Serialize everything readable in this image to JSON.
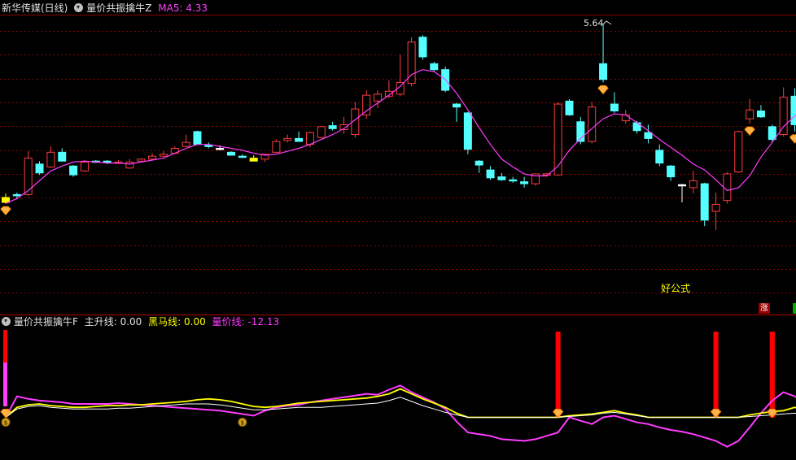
{
  "top_header": {
    "stock": "新华传媒(日线)",
    "indicator": "量价共振擒牛Z",
    "ma_label": "MA5: 4.33"
  },
  "bottom_header": {
    "indicator": "量价共振擒牛F",
    "main": "主升线: 0.00",
    "dark_horse": "黑马线: 0.00",
    "vol_price": "量价线: -12.13"
  },
  "max_label": "5.64",
  "watermark": "好公式",
  "zhang_badge": "涨",
  "colors": {
    "up": "#ff3c3c",
    "down": "#54ffff",
    "ma": "#ff3cff",
    "main": "#ffffff",
    "dark": "#ffff00",
    "vp": "#ff3cff",
    "signal": "#ff0000",
    "grid": "#8b0000"
  },
  "chart_data": {
    "type": "candlestick",
    "price_range": [
      3.35,
      5.76
    ],
    "candles": [
      {
        "o": 3.88,
        "h": 3.92,
        "l": 3.82,
        "c": 3.83,
        "col": "yellow"
      },
      {
        "o": 3.9,
        "h": 3.93,
        "l": 3.86,
        "c": 3.91,
        "col": "down"
      },
      {
        "o": 3.91,
        "h": 4.35,
        "l": 3.9,
        "c": 4.28
      },
      {
        "o": 4.22,
        "h": 4.25,
        "l": 4.11,
        "c": 4.13
      },
      {
        "o": 4.19,
        "h": 4.4,
        "l": 4.18,
        "c": 4.34
      },
      {
        "o": 4.34,
        "h": 4.38,
        "l": 4.25,
        "c": 4.25
      },
      {
        "o": 4.2,
        "h": 4.21,
        "l": 4.09,
        "c": 4.11
      },
      {
        "o": 4.15,
        "h": 4.26,
        "l": 4.14,
        "c": 4.24
      },
      {
        "o": 4.25,
        "h": 4.26,
        "l": 4.23,
        "c": 4.24
      },
      {
        "o": 4.25,
        "h": 4.26,
        "l": 4.22,
        "c": 4.235
      },
      {
        "o": 4.23,
        "h": 4.26,
        "l": 4.22,
        "c": 4.24
      },
      {
        "o": 4.18,
        "h": 4.27,
        "l": 4.17,
        "c": 4.24
      },
      {
        "o": 4.25,
        "h": 4.28,
        "l": 4.24,
        "c": 4.27
      },
      {
        "o": 4.27,
        "h": 4.33,
        "l": 4.26,
        "c": 4.3
      },
      {
        "o": 4.3,
        "h": 4.35,
        "l": 4.29,
        "c": 4.32
      },
      {
        "o": 4.33,
        "h": 4.4,
        "l": 4.32,
        "c": 4.38
      },
      {
        "o": 4.4,
        "h": 4.52,
        "l": 4.39,
        "c": 4.44
      },
      {
        "o": 4.55,
        "h": 4.56,
        "l": 4.42,
        "c": 4.42
      },
      {
        "o": 4.41,
        "h": 4.44,
        "l": 4.38,
        "c": 4.4
      },
      {
        "o": 4.37,
        "h": 4.41,
        "l": 4.36,
        "c": 4.38,
        "col": "white"
      },
      {
        "o": 4.34,
        "h": 4.35,
        "l": 4.31,
        "c": 4.31,
        "col": "down"
      },
      {
        "o": 4.3,
        "h": 4.32,
        "l": 4.28,
        "c": 4.29
      },
      {
        "o": 4.28,
        "h": 4.31,
        "l": 4.27,
        "c": 4.25,
        "col": "yellow"
      },
      {
        "o": 4.27,
        "h": 4.32,
        "l": 4.24,
        "c": 4.32
      },
      {
        "o": 4.34,
        "h": 4.47,
        "l": 4.33,
        "c": 4.45
      },
      {
        "o": 4.46,
        "h": 4.52,
        "l": 4.44,
        "c": 4.48
      },
      {
        "o": 4.48,
        "h": 4.55,
        "l": 4.46,
        "c": 4.45
      },
      {
        "o": 4.42,
        "h": 4.55,
        "l": 4.39,
        "c": 4.54
      },
      {
        "o": 4.49,
        "h": 4.61,
        "l": 4.48,
        "c": 4.6
      },
      {
        "o": 4.61,
        "h": 4.65,
        "l": 4.56,
        "c": 4.58
      },
      {
        "o": 4.57,
        "h": 4.7,
        "l": 4.53,
        "c": 4.62
      },
      {
        "o": 4.52,
        "h": 4.85,
        "l": 4.49,
        "c": 4.78
      },
      {
        "o": 4.72,
        "h": 4.97,
        "l": 4.68,
        "c": 4.92
      },
      {
        "o": 4.86,
        "h": 4.97,
        "l": 4.79,
        "c": 4.93
      },
      {
        "o": 4.91,
        "h": 5.07,
        "l": 4.89,
        "c": 4.96
      },
      {
        "o": 4.93,
        "h": 5.33,
        "l": 4.91,
        "c": 5.05
      },
      {
        "o": 5.04,
        "h": 5.51,
        "l": 5.01,
        "c": 5.46
      },
      {
        "o": 5.51,
        "h": 5.53,
        "l": 5.28,
        "c": 5.31
      },
      {
        "o": 5.24,
        "h": 5.26,
        "l": 5.16,
        "c": 5.18
      },
      {
        "o": 5.18,
        "h": 5.21,
        "l": 4.95,
        "c": 4.97
      },
      {
        "o": 4.83,
        "h": 4.84,
        "l": 4.65,
        "c": 4.8
      },
      {
        "o": 4.74,
        "h": 4.75,
        "l": 4.32,
        "c": 4.37
      },
      {
        "o": 4.25,
        "h": 4.26,
        "l": 4.13,
        "c": 4.21
      },
      {
        "o": 4.16,
        "h": 4.2,
        "l": 4.06,
        "c": 4.08
      },
      {
        "o": 4.09,
        "h": 4.13,
        "l": 4.05,
        "c": 4.06
      },
      {
        "o": 4.06,
        "h": 4.09,
        "l": 4.03,
        "c": 4.05
      },
      {
        "o": 4.04,
        "h": 4.09,
        "l": 3.98,
        "c": 4.02
      },
      {
        "o": 4.02,
        "h": 4.12,
        "l": 4.0,
        "c": 4.12
      },
      {
        "o": 4.11,
        "h": 4.13,
        "l": 4.09,
        "c": 4.12
      },
      {
        "o": 4.11,
        "h": 4.85,
        "l": 4.1,
        "c": 4.83
      },
      {
        "o": 4.86,
        "h": 4.88,
        "l": 4.71,
        "c": 4.72
      },
      {
        "o": 4.65,
        "h": 4.7,
        "l": 4.42,
        "c": 4.45
      },
      {
        "o": 4.45,
        "h": 4.85,
        "l": 4.43,
        "c": 4.8
      },
      {
        "o": 5.24,
        "h": 5.64,
        "l": 5.05,
        "c": 5.08
      },
      {
        "o": 4.83,
        "h": 4.95,
        "l": 4.74,
        "c": 4.76
      },
      {
        "o": 4.66,
        "h": 4.77,
        "l": 4.63,
        "c": 4.72
      },
      {
        "o": 4.64,
        "h": 4.66,
        "l": 4.53,
        "c": 4.56
      },
      {
        "o": 4.54,
        "h": 4.62,
        "l": 4.43,
        "c": 4.48
      },
      {
        "o": 4.36,
        "h": 4.42,
        "l": 4.2,
        "c": 4.23
      },
      {
        "o": 4.2,
        "h": 4.21,
        "l": 4.05,
        "c": 4.09
      },
      {
        "o": 4.0,
        "h": 4.02,
        "l": 3.83,
        "c": 4.01,
        "col": "white"
      },
      {
        "o": 3.98,
        "h": 4.15,
        "l": 3.92,
        "c": 4.05
      },
      {
        "o": 4.02,
        "h": 4.03,
        "l": 3.59,
        "c": 3.65
      },
      {
        "o": 3.74,
        "h": 3.93,
        "l": 3.55,
        "c": 3.81
      },
      {
        "o": 3.85,
        "h": 4.14,
        "l": 3.82,
        "c": 4.12
      },
      {
        "o": 4.14,
        "h": 4.56,
        "l": 4.13,
        "c": 4.55
      },
      {
        "o": 4.68,
        "h": 4.88,
        "l": 4.63,
        "c": 4.77
      },
      {
        "o": 4.76,
        "h": 4.82,
        "l": 4.69,
        "c": 4.7
      },
      {
        "o": 4.6,
        "h": 4.62,
        "l": 4.44,
        "c": 4.47
      },
      {
        "o": 4.52,
        "h": 5.0,
        "l": 4.5,
        "c": 4.9
      },
      {
        "o": 4.91,
        "h": 4.99,
        "l": 4.55,
        "c": 4.62
      },
      {
        "o": 4.65,
        "h": 4.98,
        "l": 4.62,
        "c": 4.95
      },
      {
        "o": 4.82,
        "h": 5.1,
        "l": 4.65,
        "c": 4.7
      }
    ],
    "ma5": [
      3.82,
      3.87,
      3.95,
      4.05,
      4.15,
      4.2,
      4.24,
      4.25,
      4.24,
      4.23,
      4.23,
      4.22,
      4.24,
      4.26,
      4.28,
      4.33,
      4.38,
      4.42,
      4.42,
      4.4,
      4.38,
      4.36,
      4.33,
      4.31,
      4.32,
      4.35,
      4.38,
      4.42,
      4.47,
      4.52,
      4.58,
      4.67,
      4.76,
      4.84,
      4.92,
      5.01,
      5.13,
      5.18,
      5.16,
      5.08,
      4.94,
      4.77,
      4.59,
      4.42,
      4.27,
      4.19,
      4.12,
      4.1,
      4.1,
      4.2,
      4.36,
      4.48,
      4.58,
      4.68,
      4.73,
      4.72,
      4.64,
      4.56,
      4.47,
      4.39,
      4.31,
      4.22,
      4.16,
      4.06,
      3.95,
      3.98,
      4.1,
      4.29,
      4.44,
      4.6,
      4.71,
      4.76,
      4.8
    ],
    "signals_up": [
      0,
      45,
      54,
      63,
      68,
      72
    ],
    "diamond_markers": [
      0,
      53,
      66,
      70
    ],
    "money_markers": [
      0,
      21
    ],
    "osc_range": [
      -45,
      110
    ],
    "main_line": [
      0,
      10,
      13,
      14,
      12,
      11,
      10,
      10,
      10,
      10,
      11,
      11,
      12,
      13,
      14,
      15,
      16,
      16,
      16,
      15,
      13,
      11,
      9,
      9,
      10,
      11,
      12,
      12,
      12,
      13,
      14,
      15,
      16,
      17,
      20,
      24,
      19,
      14,
      10,
      6,
      3,
      0,
      0,
      0,
      0,
      0,
      0,
      0,
      0,
      0,
      1,
      2,
      3,
      5,
      6,
      4,
      2,
      0,
      0,
      0,
      0,
      0,
      0,
      0,
      0,
      0,
      1,
      2,
      3,
      4,
      5,
      3,
      2
    ],
    "dark_horse_line": [
      0,
      12,
      15,
      16,
      14,
      13,
      12,
      12,
      13,
      14,
      14,
      15,
      15,
      16,
      17,
      18,
      19,
      21,
      22,
      21,
      19,
      16,
      13,
      12,
      13,
      15,
      17,
      18,
      19,
      20,
      21,
      22,
      23,
      25,
      28,
      34,
      28,
      22,
      17,
      12,
      5,
      0,
      0,
      0,
      0,
      0,
      0,
      0,
      0,
      0,
      2,
      3,
      4,
      6,
      8,
      5,
      3,
      0,
      0,
      0,
      0,
      0,
      0,
      0,
      0,
      0,
      3,
      5,
      7,
      8,
      12,
      8,
      5
    ],
    "vol_price_line": [
      0,
      25,
      22,
      20,
      19,
      18,
      16,
      16,
      16,
      16,
      17,
      16,
      15,
      14,
      13,
      12,
      11,
      10,
      9,
      8,
      6,
      4,
      2,
      8,
      12,
      14,
      15,
      18,
      20,
      22,
      24,
      26,
      28,
      27,
      33,
      38,
      30,
      24,
      18,
      10,
      -5,
      -18,
      -20,
      -22,
      -26,
      -27,
      -28,
      -26,
      -22,
      -18,
      0,
      -4,
      -8,
      0,
      2,
      -2,
      -6,
      -8,
      -12,
      -15,
      -17,
      -20,
      -24,
      -28,
      -35,
      -28,
      -12,
      5,
      20,
      30,
      25,
      18,
      26
    ]
  }
}
